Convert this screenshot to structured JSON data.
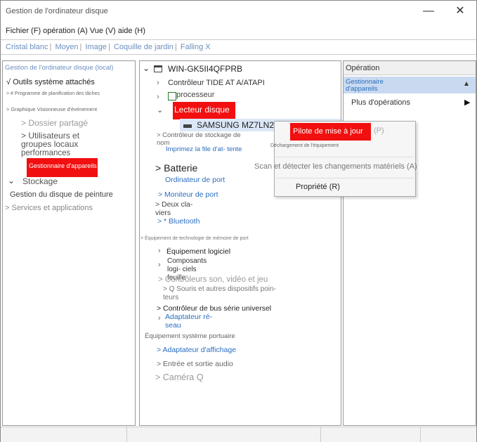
{
  "window": {
    "title": "Gestion de l'ordinateur disque",
    "minimize_glyph": "—",
    "close_glyph": "✕"
  },
  "menubar": {
    "text": "Fichier (F) opération (A) Vue (V) aide (H)"
  },
  "toolbar": {
    "items": [
      "Cristal blanc",
      "Moyen",
      "Image",
      "Coquille de jardin",
      "Falling X"
    ]
  },
  "left_pane": {
    "header": "Gestion de l'ordinateur disque (local)",
    "tools": "√ Outils système attachés",
    "scheduler": "> # Programme de planification des tâches",
    "event_viewer": "> Graphique Visionneuse d'événement",
    "shared_folder": "> Dossier partagé",
    "users_groups": "> Utilisateurs et groupes locaux",
    "performance": "performances",
    "perf_prefix": "performances",
    "device_manager": "Gestionnaire d'appareils",
    "storage": "Stockage",
    "disk_management": "Gestion du disque de peinture",
    "services": "> Services et applications"
  },
  "tree": {
    "root": "WIN-GK5II4QFPRB",
    "ide": "Contrôleur TIDE AT A/ATAPI",
    "processor": "processeur",
    "disk_drive": "Lecteur disque",
    "samsung": "SAMSUNG MZ7LN2",
    "storage_ctrl": "> Contrôleur de stockage de nom",
    "print_queue": "Imprimez la file d'at- tente",
    "battery": "> Batterie",
    "port_computer": "Ordinateur de port",
    "port_monitor": "> Moniteur de port",
    "keyboards": "> Deux cla- viers",
    "bluetooth": "> * Bluetooth",
    "memory_tech": "> Équipement de technologie de mémoire de port",
    "software_equipment": "Équipement logiciel",
    "software_components": "Composants logi- ciels feuille",
    "sound": "> Contrôleurs son, vidéo et jeu",
    "mice": "> Q Souris et autres dispositifs poin- teurs",
    "usb": "> Contrôleur de bus série universel",
    "network": "Adaptateur ré- seau",
    "portable": "Équipement système portuaire",
    "display": "> Adaptateur d'affichage",
    "audio_io": "> Entrée et sortie audio",
    "camera": "> Caméra Q"
  },
  "context_menu": {
    "update_driver": "Pilote de mise à jour",
    "update_driver_suffix": "(P)",
    "unload": "Déchargement de l'équipement",
    "scan": "Scan et détecter les changements matériels (A)",
    "properties": "Propriété (R)"
  },
  "actions_pane": {
    "header": "Opération",
    "section": "Gestionnaire d'appareils",
    "more": "Plus d'opérations"
  },
  "colors": {
    "highlight_red": "#f20f0f",
    "link_blue": "#2a6ebf",
    "section_blue": "#c9daf0"
  }
}
